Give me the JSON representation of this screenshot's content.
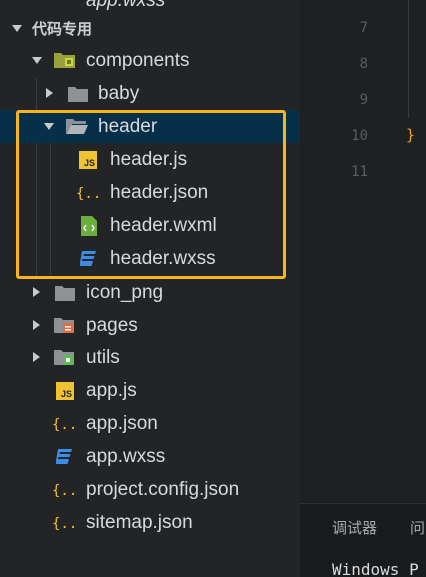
{
  "top_partial": {
    "label": "app.wxss"
  },
  "section": {
    "label": "代码专用"
  },
  "tree": {
    "components": "components",
    "baby": "baby",
    "header": "header",
    "header_js": "header.js",
    "header_json": "header.json",
    "header_wxml": "header.wxml",
    "header_wxss": "header.wxss",
    "icon_png": "icon_png",
    "pages": "pages",
    "utils": "utils",
    "app_js": "app.js",
    "app_json": "app.json",
    "app_wxss": "app.wxss",
    "project_config": "project.config.json",
    "sitemap": "sitemap.json"
  },
  "editor": {
    "line_numbers": [
      "7",
      "8",
      "9",
      "10",
      "11"
    ],
    "closing_brace": "}"
  },
  "bottom": {
    "tab_debugger": "调试器",
    "tab_problems": "问",
    "console_text": "Windows P"
  },
  "colors": {
    "highlight_border": "#f7b51b",
    "selected_row": "#062f4a",
    "js_icon": "#f1c232",
    "wxml_icon": "#6cae3e",
    "wxss_icon": "#3b8ee8",
    "folder_gray": "#8e9297",
    "pages_folder": "#e06a4a",
    "utils_folder": "#5fb85a"
  }
}
